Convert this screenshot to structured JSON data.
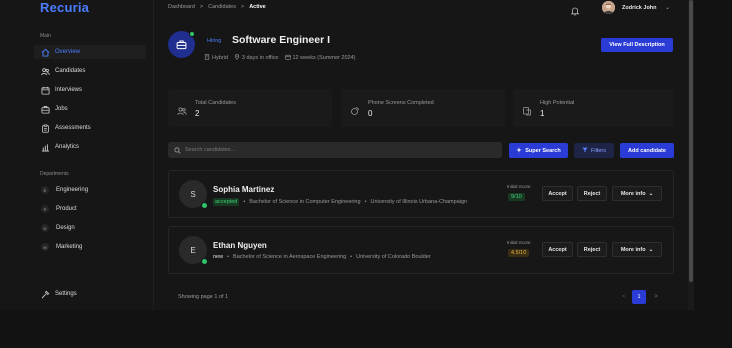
{
  "app": {
    "logo": "Recuria"
  },
  "sidebar": {
    "main_label": "Main",
    "items": [
      {
        "label": "Overview",
        "icon": "home-icon"
      },
      {
        "label": "Candidates",
        "icon": "users-icon"
      },
      {
        "label": "Interviews",
        "icon": "calendar-icon"
      },
      {
        "label": "Jobs",
        "icon": "briefcase-icon"
      },
      {
        "label": "Assessments",
        "icon": "clipboard-icon"
      },
      {
        "label": "Analytics",
        "icon": "bar-chart-icon"
      }
    ],
    "departments_label": "Departments",
    "departments": [
      {
        "badge": "E",
        "label": "Engineering"
      },
      {
        "badge": "P",
        "label": "Product"
      },
      {
        "badge": "D",
        "label": "Design"
      },
      {
        "badge": "M",
        "label": "Marketing"
      }
    ],
    "settings_label": "Settings"
  },
  "breadcrumb": {
    "first": "Dashboard",
    "second": "Candidates",
    "current": "Active",
    "sep": ">"
  },
  "user": {
    "name": "Zodrick John"
  },
  "job": {
    "status": "Hiring",
    "title": "Software Engineer I",
    "work_mode": "Hybrid",
    "office_days": "3 days in office",
    "duration": "12 weeks (Summer 2024)",
    "view_button": "View Full Description"
  },
  "stats": [
    {
      "label": "Total Candidates",
      "value": "2"
    },
    {
      "label": "Phone Screens Completed",
      "value": "0"
    },
    {
      "label": "High Potential",
      "value": "1"
    }
  ],
  "search": {
    "placeholder": "Search candidates..."
  },
  "actions": {
    "super_search": "Super Search",
    "filters": "Filters",
    "add_candidate": "Add candidate"
  },
  "candidates": [
    {
      "initial": "S",
      "name": "Sophia Martinez",
      "status": "accepted",
      "degree": "Bachelor of Science in Computer Engineering",
      "school": "University of Illinois Urbana-Champaign",
      "score_label": "Initial Score",
      "score": "9/10",
      "accept": "Accept",
      "reject": "Reject",
      "more": "More info"
    },
    {
      "initial": "E",
      "name": "Ethan Nguyen",
      "status": "new",
      "degree": "Bachelor of Science in Aerospace Engineering",
      "school": "University of Colorado Boulder",
      "score_label": "Initial Score",
      "score": "4.5/10",
      "accept": "Accept",
      "reject": "Reject",
      "more": "More info"
    }
  ],
  "pagination": {
    "showing": "Showing page 1 of 1",
    "current": "1",
    "prev": "<",
    "next": ">"
  },
  "colors": {
    "accent": "#2a3bd6",
    "link": "#4a7dff",
    "success": "#30c46a",
    "warning": "#e7b43a"
  }
}
